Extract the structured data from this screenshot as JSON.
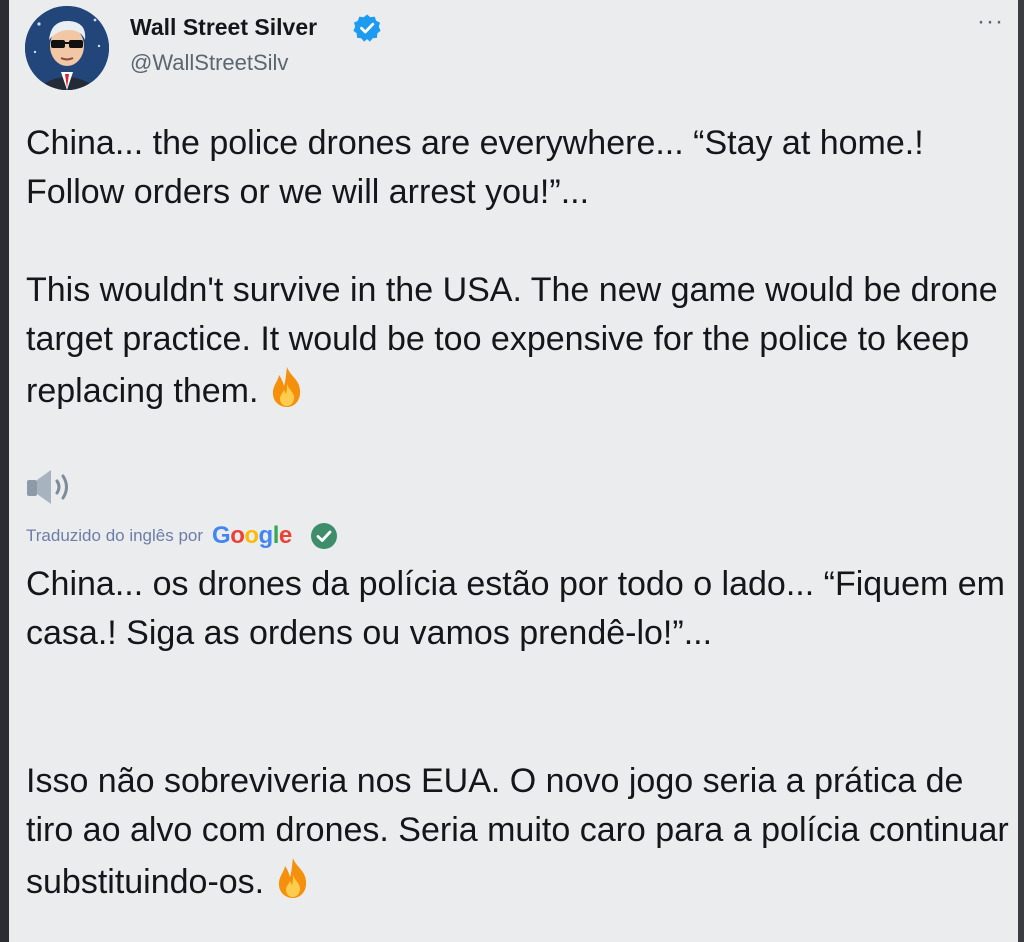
{
  "author": {
    "display_name": "Wall Street Silver",
    "handle": "@WallStreetSilv",
    "verified": true
  },
  "menu": {
    "more_label": "···"
  },
  "tweet": {
    "paragraph_1": "China... the police drones are everywhere... “Stay at home.! Follow orders or we will arrest you!”...",
    "paragraph_2": "This wouldn't survive in the USA. The new game would be drone target practice. It would be too expensive for the police to keep replacing them.",
    "emoji": "fire"
  },
  "translation": {
    "label": "Traduzido do inglês por",
    "provider": "Google",
    "paragraph_1": "China... os drones da polícia estão por todo o lado... “Fiquem em casa.! Siga as ordens ou vamos prendê-lo!”...",
    "paragraph_2": "Isso não sobreviveria nos EUA. O novo jogo seria a prática de tiro ao alvo com drones. Seria muito caro para a polícia continuar substituindo-os."
  },
  "colors": {
    "verified_blue": "#1d9bf0",
    "check_green": "#3e8e6c",
    "google_blue": "#4285f4",
    "google_red": "#ea4335",
    "google_yellow": "#fbbc05",
    "google_green": "#34a853"
  }
}
